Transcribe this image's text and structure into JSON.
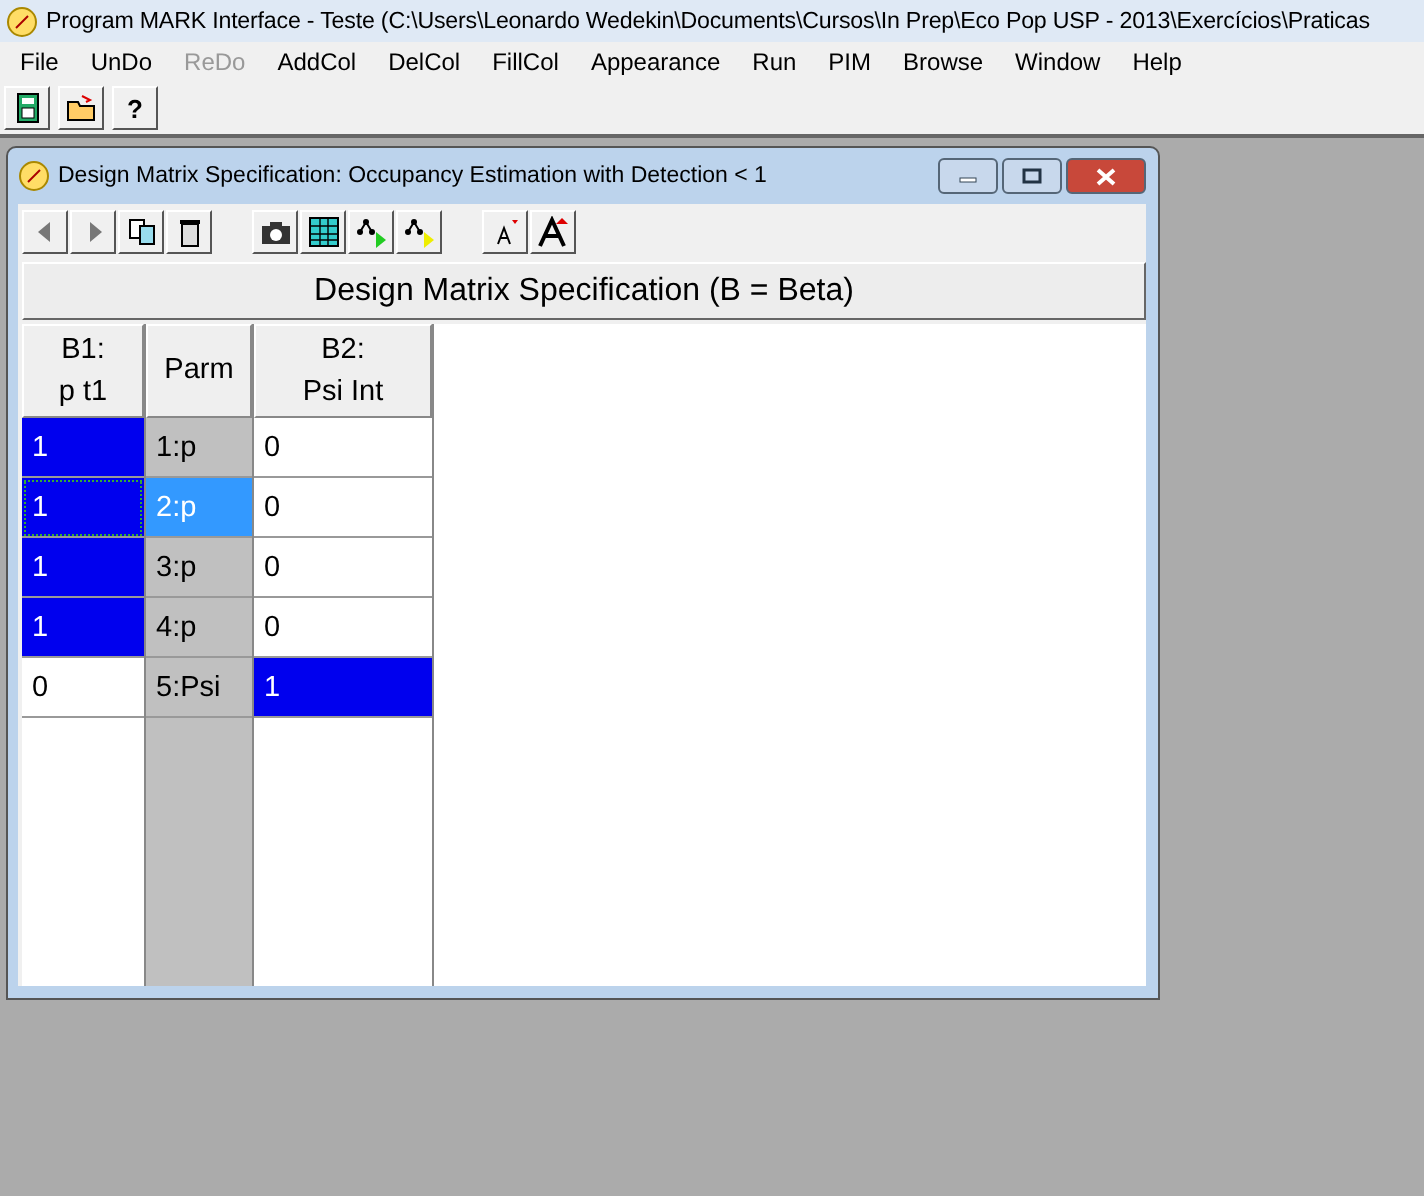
{
  "window": {
    "title": "Program MARK Interface - Teste  (C:\\Users\\Leonardo Wedekin\\Documents\\Cursos\\In Prep\\Eco Pop USP - 2013\\Exercícios\\Praticas"
  },
  "menu": [
    {
      "label": "File",
      "disabled": false
    },
    {
      "label": "UnDo",
      "disabled": false
    },
    {
      "label": "ReDo",
      "disabled": true
    },
    {
      "label": "AddCol",
      "disabled": false
    },
    {
      "label": "DelCol",
      "disabled": false
    },
    {
      "label": "FillCol",
      "disabled": false
    },
    {
      "label": "Appearance",
      "disabled": false
    },
    {
      "label": "Run",
      "disabled": false
    },
    {
      "label": "PIM",
      "disabled": false
    },
    {
      "label": "Browse",
      "disabled": false
    },
    {
      "label": "Window",
      "disabled": false
    },
    {
      "label": "Help",
      "disabled": false
    }
  ],
  "toolbar": [
    {
      "kind": "calculator"
    },
    {
      "kind": "open"
    },
    {
      "kind": "help",
      "label": "?"
    }
  ],
  "child_window": {
    "title": "Design Matrix Specification: Occupancy Estimation with Detection < 1",
    "toolbar": [
      {
        "kind": "back"
      },
      {
        "kind": "forward"
      },
      {
        "kind": "copy"
      },
      {
        "kind": "trash"
      },
      {
        "kind": "gap"
      },
      {
        "kind": "camera"
      },
      {
        "kind": "grid"
      },
      {
        "kind": "tree-green"
      },
      {
        "kind": "tree-yellow"
      },
      {
        "kind": "gap"
      },
      {
        "kind": "font-small"
      },
      {
        "kind": "font-large"
      }
    ],
    "heading": "Design Matrix Specification (B = Beta)",
    "columns": [
      {
        "line1": "B1:",
        "line2": "p t1"
      },
      {
        "line1": "Parm"
      },
      {
        "line1": "B2:",
        "line2": "Psi Int"
      }
    ],
    "rows": [
      {
        "b1": {
          "value": "1",
          "highlighted": true,
          "focused": false
        },
        "parm": {
          "label": "1:p",
          "selected": false
        },
        "b2": {
          "value": "0",
          "highlighted": false
        }
      },
      {
        "b1": {
          "value": "1",
          "highlighted": true,
          "focused": true
        },
        "parm": {
          "label": "2:p",
          "selected": true
        },
        "b2": {
          "value": "0",
          "highlighted": false
        }
      },
      {
        "b1": {
          "value": "1",
          "highlighted": true,
          "focused": false
        },
        "parm": {
          "label": "3:p",
          "selected": false
        },
        "b2": {
          "value": "0",
          "highlighted": false
        }
      },
      {
        "b1": {
          "value": "1",
          "highlighted": true,
          "focused": false
        },
        "parm": {
          "label": "4:p",
          "selected": false
        },
        "b2": {
          "value": "0",
          "highlighted": false
        }
      },
      {
        "b1": {
          "value": "0",
          "highlighted": false,
          "focused": false
        },
        "parm": {
          "label": "5:Psi",
          "selected": false
        },
        "b2": {
          "value": "1",
          "highlighted": true
        }
      }
    ]
  }
}
